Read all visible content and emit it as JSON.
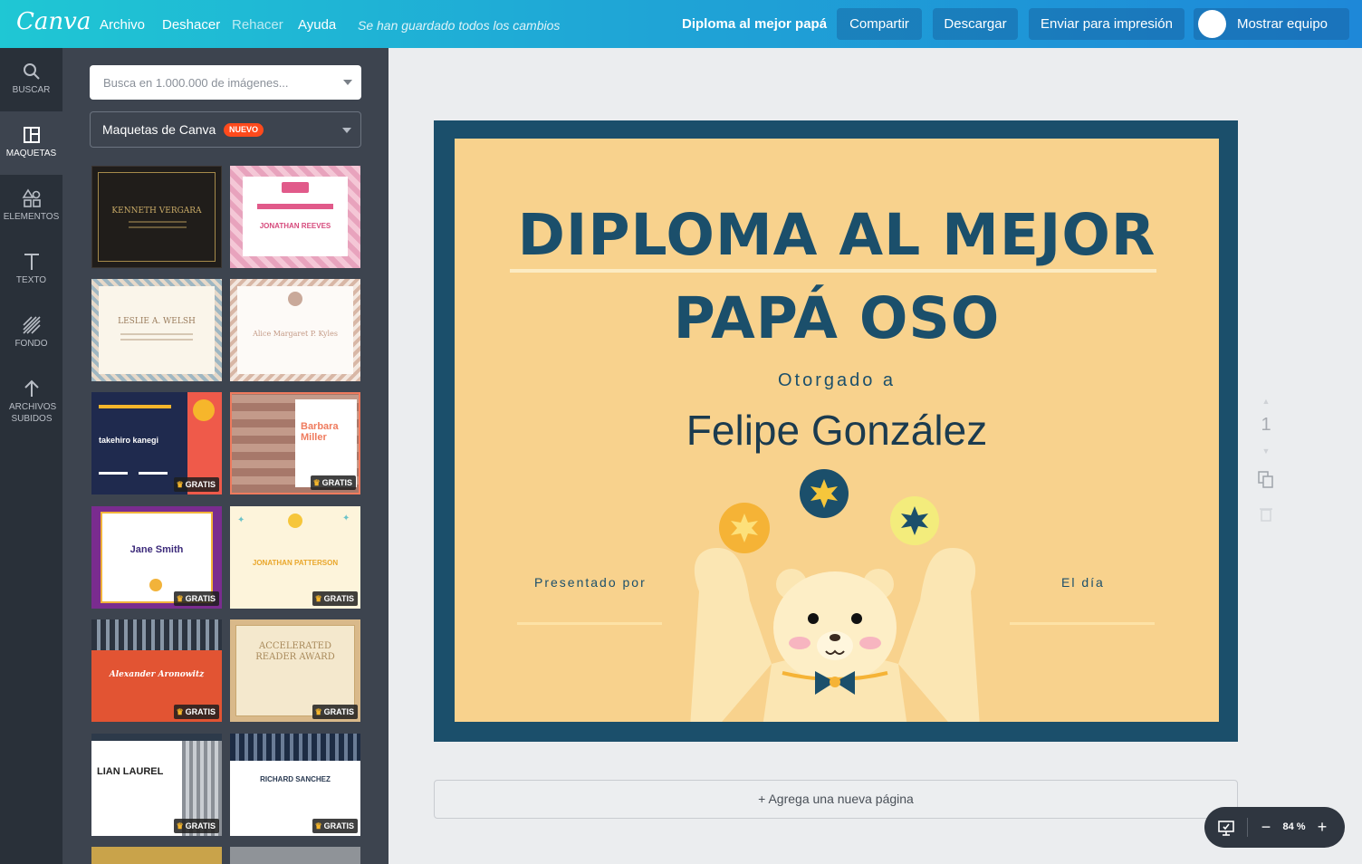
{
  "topbar": {
    "logo": "Canva",
    "menu": [
      "Archivo",
      "Deshacer",
      "Rehacer",
      "Ayuda"
    ],
    "saved_status": "Se han guardado todos los cambios",
    "doc_title": "Diploma al mejor papá",
    "share_label": "Compartir",
    "download_label": "Descargar",
    "print_label": "Enviar para impresión",
    "team_label": "Mostrar equipo"
  },
  "rail": [
    {
      "label": "BUSCAR",
      "icon": "search-icon"
    },
    {
      "label": "MAQUETAS",
      "icon": "layout-icon"
    },
    {
      "label": "ELEMENTOS",
      "icon": "shapes-icon"
    },
    {
      "label": "TEXTO",
      "icon": "text-icon"
    },
    {
      "label": "FONDO",
      "icon": "background-icon"
    },
    {
      "label": "ARCHIVOS SUBIDOS",
      "icon": "upload-icon"
    }
  ],
  "panel": {
    "search_placeholder": "Busca en 1.000.000 de imágenes...",
    "filter_label": "Maquetas de Canva",
    "filter_badge": "NUEVO",
    "free_label": "GRATIS",
    "thumbs": [
      {
        "name": "KENNETH VERGARA",
        "free": false
      },
      {
        "name": "JONATHAN REEVES",
        "free": false
      },
      {
        "name": "LESLIE A. WELSH",
        "free": false
      },
      {
        "name": "Alice Margaret P. Kyles",
        "free": false
      },
      {
        "name": "takehiro kanegi",
        "free": true
      },
      {
        "name": "Barbara Miller",
        "free": true
      },
      {
        "name": "Jane Smith",
        "free": true
      },
      {
        "name": "JONATHAN PATTERSON",
        "free": true
      },
      {
        "name": "Alexander Aronowitz",
        "free": true
      },
      {
        "name": "ACCELERATED READER AWARD",
        "free": true
      },
      {
        "name": "LIAN LAUREL",
        "free": true
      },
      {
        "name": "RICHARD SANCHEZ",
        "free": true
      }
    ]
  },
  "document": {
    "title_line1": "DIPLOMA AL MEJOR",
    "title_line2": "PAPÁ OSO",
    "awarded_to": "Otorgado a",
    "recipient": "Felipe González",
    "presented_by": "Presentado por",
    "date_label": "El día",
    "colors": {
      "border": "#1b4f6b",
      "background": "#f8d28d"
    }
  },
  "page_number": "1",
  "add_page_label": "+ Agrega una nueva página",
  "zoom": {
    "level": "84 %",
    "minus": "−",
    "plus": "+"
  }
}
